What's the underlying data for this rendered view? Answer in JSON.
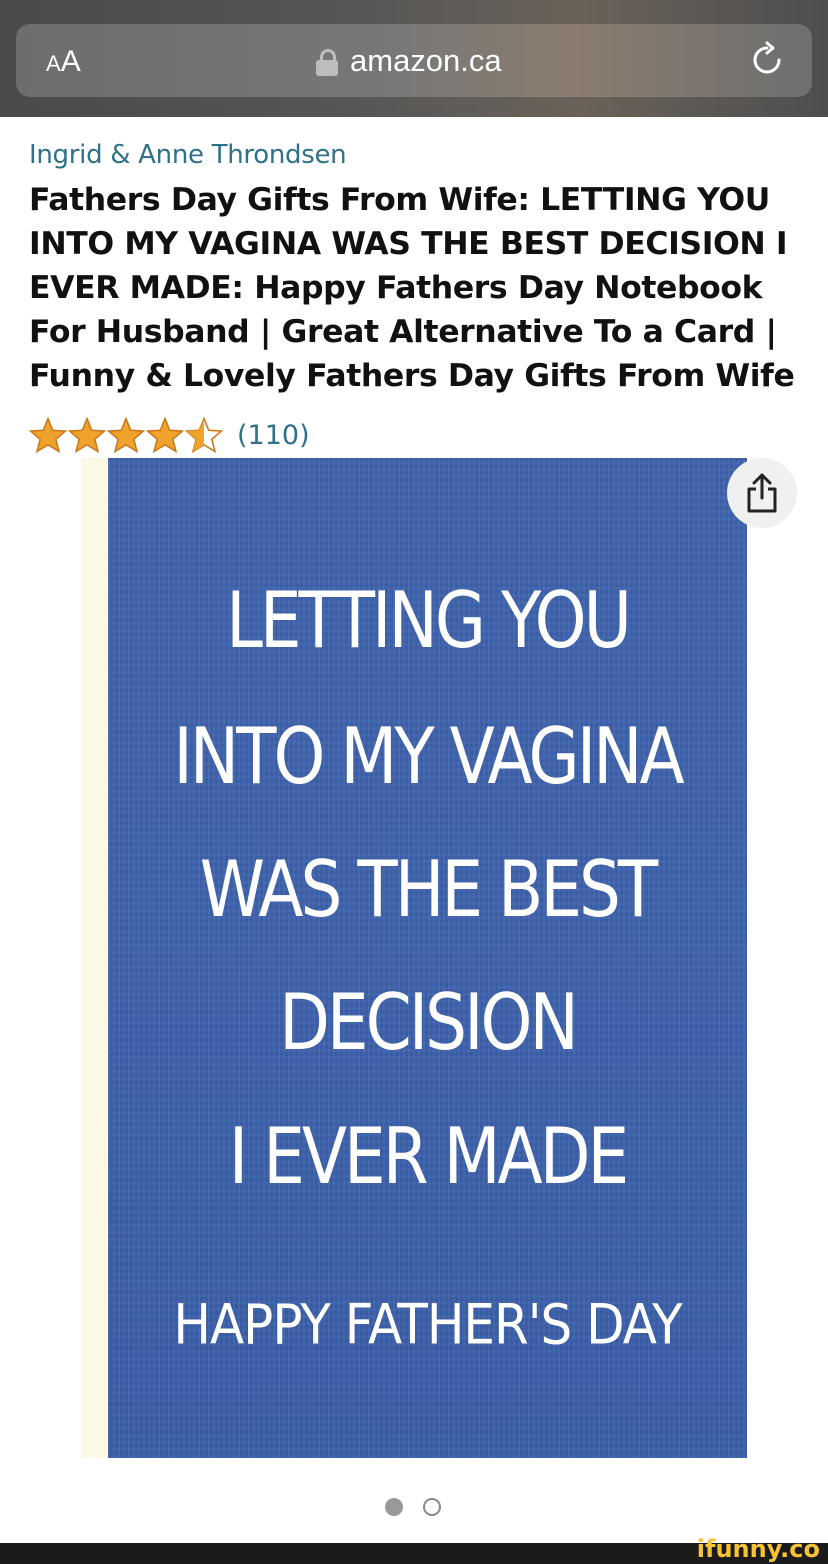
{
  "browser": {
    "text_size_label_small": "A",
    "text_size_label_big": "A",
    "domain": "amazon.ca",
    "lock_icon": "lock-icon",
    "reload_icon": "reload-icon"
  },
  "product": {
    "author": "Ingrid & Anne Throndsen",
    "title": "Fathers Day Gifts From Wife: LETTING YOU INTO MY VAGINA WAS THE BEST DECISION I EVER MADE: Happy Fathers Day Notebook For Husband | Great Alternative To a Card | Funny & Lovely Fathers Day Gifts From Wife",
    "rating_stars": 4.5,
    "review_count": "(110)",
    "star_color": "#f0a32c",
    "link_color": "#2f7189"
  },
  "cover": {
    "lines": [
      "LETTING YOU",
      "INTO MY VAGINA",
      "WAS THE BEST",
      "DECISION",
      "I EVER MADE"
    ],
    "subtitle": "HAPPY FATHER'S DAY",
    "background_color": "#3d62ac"
  },
  "carousel": {
    "total_pages": 2,
    "current_page": 1
  },
  "footer": {
    "watermark": "ifunny.co"
  }
}
